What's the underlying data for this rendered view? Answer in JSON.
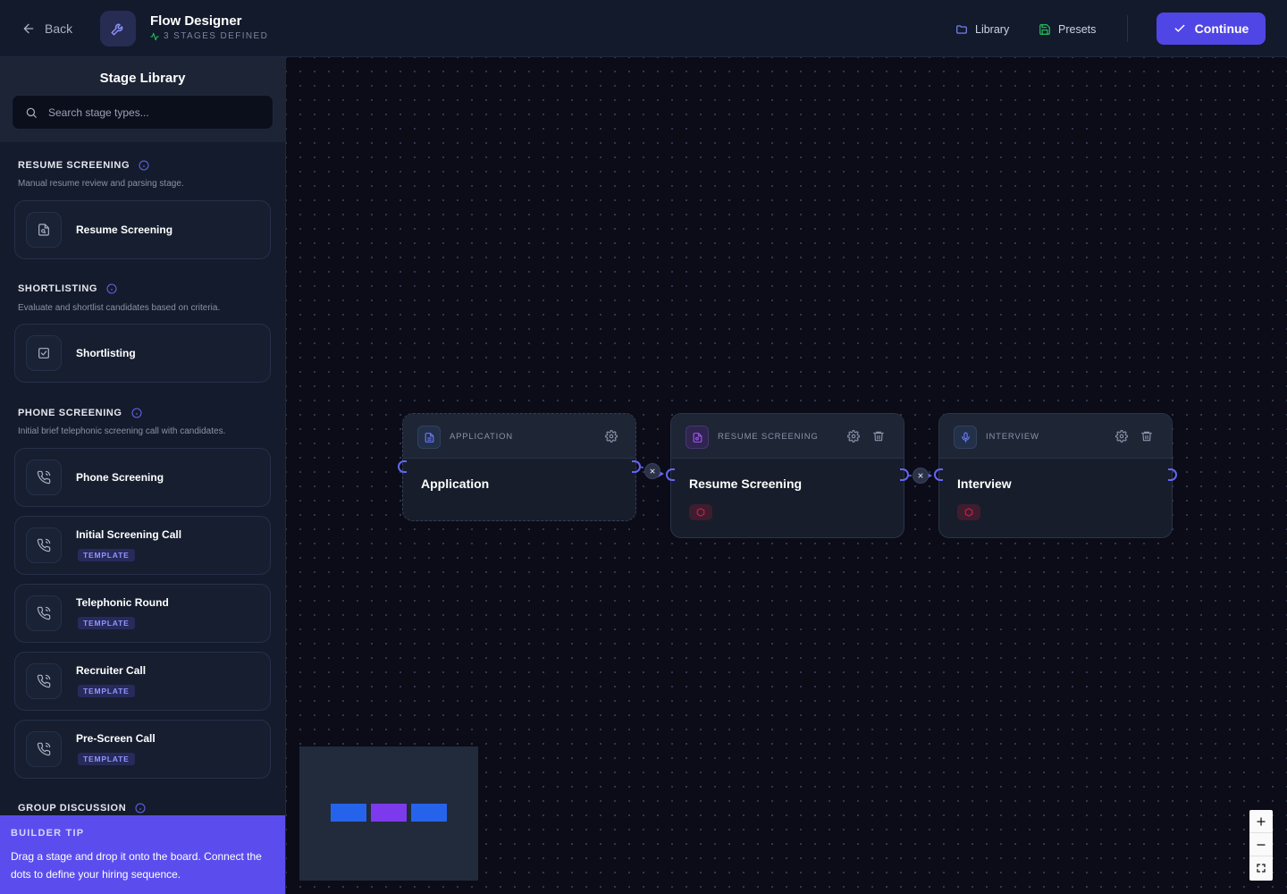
{
  "header": {
    "back_label": "Back",
    "title": "Flow Designer",
    "subtitle": "3 STAGES DEFINED",
    "library_label": "Library",
    "presets_label": "Presets",
    "continue_label": "Continue"
  },
  "sidebar": {
    "title": "Stage Library",
    "search_placeholder": "Search stage types...",
    "categories": [
      {
        "title": "RESUME SCREENING",
        "description": "Manual resume review and parsing stage.",
        "stages": [
          {
            "name": "Resume Screening"
          }
        ]
      },
      {
        "title": "SHORTLISTING",
        "description": "Evaluate and shortlist candidates based on criteria.",
        "stages": [
          {
            "name": "Shortlisting"
          }
        ]
      },
      {
        "title": "PHONE SCREENING",
        "description": "Initial brief telephonic screening call with candidates.",
        "stages": [
          {
            "name": "Phone Screening"
          },
          {
            "name": "Initial Screening Call",
            "badge": "TEMPLATE"
          },
          {
            "name": "Telephonic Round",
            "badge": "TEMPLATE"
          },
          {
            "name": "Recruiter Call",
            "badge": "TEMPLATE"
          },
          {
            "name": "Pre-Screen Call",
            "badge": "TEMPLATE"
          }
        ]
      },
      {
        "title": "GROUP DISCUSSION",
        "description": "",
        "stages": []
      }
    ],
    "tip": {
      "title": "BUILDER TIP",
      "text": "Drag a stage and drop it onto the board. Connect the dots to define your hiring sequence."
    }
  },
  "canvas": {
    "nodes": [
      {
        "type": "APPLICATION",
        "title": "Application",
        "icon": "document-icon"
      },
      {
        "type": "RESUME SCREENING",
        "title": "Resume Screening",
        "icon": "file-scan-icon"
      },
      {
        "type": "INTERVIEW",
        "title": "Interview",
        "icon": "mic-icon"
      }
    ],
    "minimap_colors": [
      "#2563eb",
      "#7c3aed",
      "#2563eb"
    ]
  },
  "colors": {
    "accent": "#5046e5",
    "handle": "#6366f1",
    "tip_bg": "#5b4ded"
  }
}
